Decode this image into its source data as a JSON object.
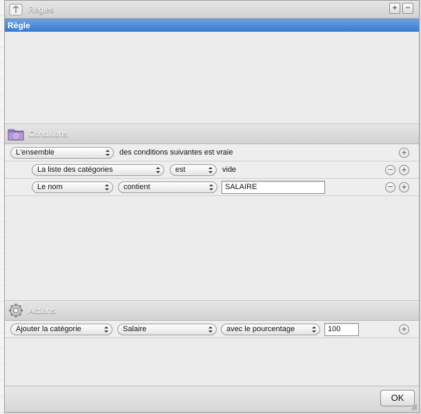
{
  "window": {
    "title": "Règles",
    "add_label": "+",
    "remove_label": "−"
  },
  "rules": {
    "items": [
      {
        "label": "Règle",
        "selected": true
      }
    ]
  },
  "conditions": {
    "title": "Conditions",
    "match_popup": "L'ensemble",
    "match_text": "des conditions suivantes est vraie",
    "rows": [
      {
        "field": "La liste des catégories",
        "operator": "est",
        "value_text": "vide"
      },
      {
        "field": "Le nom",
        "operator": "contient",
        "value": "SALAIRE"
      }
    ]
  },
  "actions": {
    "title": "Actions",
    "rows": [
      {
        "action": "Ajouter la catégorie",
        "category": "Salaire",
        "mode": "avec le pourcentage",
        "value": "100"
      }
    ]
  },
  "footer": {
    "ok_label": "OK"
  },
  "icons": {
    "rules": "rules-icon",
    "conditions": "folder-icon",
    "actions": "gear-icon"
  },
  "colors": {
    "selection": "#3878d0",
    "panel": "#ececec"
  }
}
